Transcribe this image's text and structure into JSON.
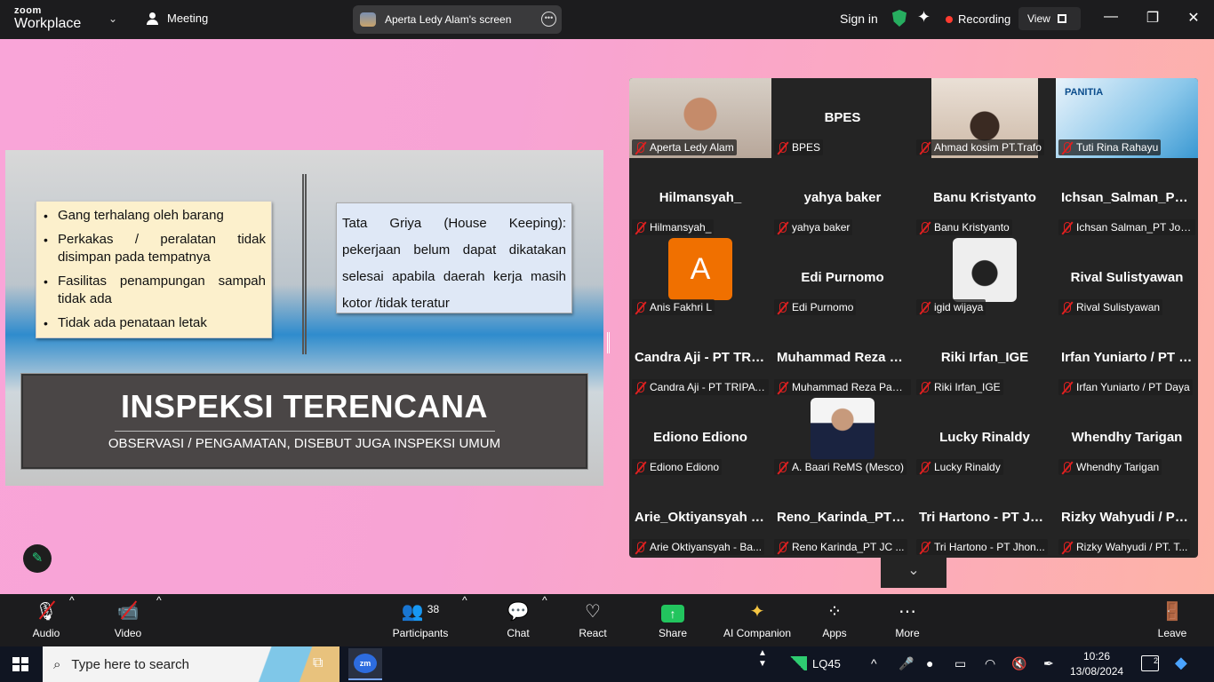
{
  "topbar": {
    "logo_top": "zoom",
    "logo_bottom": "Workplace",
    "meeting_label": "Meeting",
    "share_label": "Aperta Ledy Alam's screen",
    "sign_in": "Sign in",
    "recording": "Recording",
    "view": "View"
  },
  "slide": {
    "bullets": [
      "Gang terhalang oleh barang",
      "Perkakas / peralatan tidak disimpan pada tempatnya",
      "Fasilitas penampungan sampah tidak ada",
      "Tidak ada penataan letak"
    ],
    "right_text": "Tata Griya (House Keeping): pekerjaan belum dapat dikatakan selesai apabila daerah kerja masih kotor /tidak teratur",
    "title": "INSPEKSI TERENCANA",
    "subtitle": "OBSERVASI / PENGAMATAN, DISEBUT JUGA INSPEKSI UMUM"
  },
  "gallery": [
    {
      "big": "",
      "label": "Aperta Ledy Alam",
      "type": "video-man",
      "active": true
    },
    {
      "big": "BPES",
      "label": "BPES"
    },
    {
      "big": "",
      "label": "Ahmad kosim PT.Trafo",
      "type": "video-man2"
    },
    {
      "big": "",
      "label": "Tuti Rina Rahayu",
      "type": "poster",
      "poster_text": "PANITIA"
    },
    {
      "big": "Hilmansyah_",
      "label": "Hilmansyah_"
    },
    {
      "big": "yahya baker",
      "label": "yahya baker"
    },
    {
      "big": "Banu Kristyanto",
      "label": "Banu Kristyanto"
    },
    {
      "big": "Ichsan_Salman_PT Johnson",
      "label": "Ichsan Salman_PT Johnson"
    },
    {
      "big": "",
      "label": "Anis Fakhri L",
      "type": "avatar-a",
      "avatar_letter": "A"
    },
    {
      "big": "Edi Purnomo",
      "label": "Edi Purnomo"
    },
    {
      "big": "",
      "label": "igid wijaya",
      "type": "sketch"
    },
    {
      "big": "Rival Sulistyawan",
      "label": "Rival Sulistyawan"
    },
    {
      "big": "Candra Aji - PT TRIPATRA",
      "label": "Candra Aji - PT TRIPATRA"
    },
    {
      "big": "Muhammad Reza Pahlevi",
      "label": "Muhammad Reza Pahlevi"
    },
    {
      "big": "Riki Irfan_IGE",
      "label": "Riki Irfan_IGE"
    },
    {
      "big": "Irfan Yuniarto / PT Daya",
      "label": "Irfan Yuniarto / PT Daya"
    },
    {
      "big": "Ediono Ediono",
      "label": "Ediono Ediono"
    },
    {
      "big": "",
      "label": "A. Baari ReMS (Mesco)",
      "type": "suit"
    },
    {
      "big": "Lucky Rinaldy",
      "label": "Lucky Rinaldy"
    },
    {
      "big": "Whendhy Tarigan",
      "label": "Whendhy Tarigan"
    },
    {
      "big": "Arie_Oktiyansyah - Ba...",
      "label": "Arie Oktiyansyah - Ba..."
    },
    {
      "big": "Reno_Karinda_PT JC...",
      "label": "Reno Karinda_PT JC ..."
    },
    {
      "big": "Tri Hartono - PT Jhonson",
      "label": "Tri Hartono - PT Jhon..."
    },
    {
      "big": "Rizky Wahyudi / PT. T",
      "label": "Rizky Wahyudi / PT. T..."
    }
  ],
  "toolbar": {
    "audio": "Audio",
    "video": "Video",
    "participants": "Participants",
    "participants_count": "38",
    "chat": "Chat",
    "react": "React",
    "share": "Share",
    "ai": "AI Companion",
    "apps": "Apps",
    "more": "More",
    "leave": "Leave"
  },
  "taskbar": {
    "search_placeholder": "Type here to search",
    "zoom_app": "zm",
    "stock": "LQ45",
    "time": "10:26",
    "date": "13/08/2024",
    "notifications": "2"
  }
}
